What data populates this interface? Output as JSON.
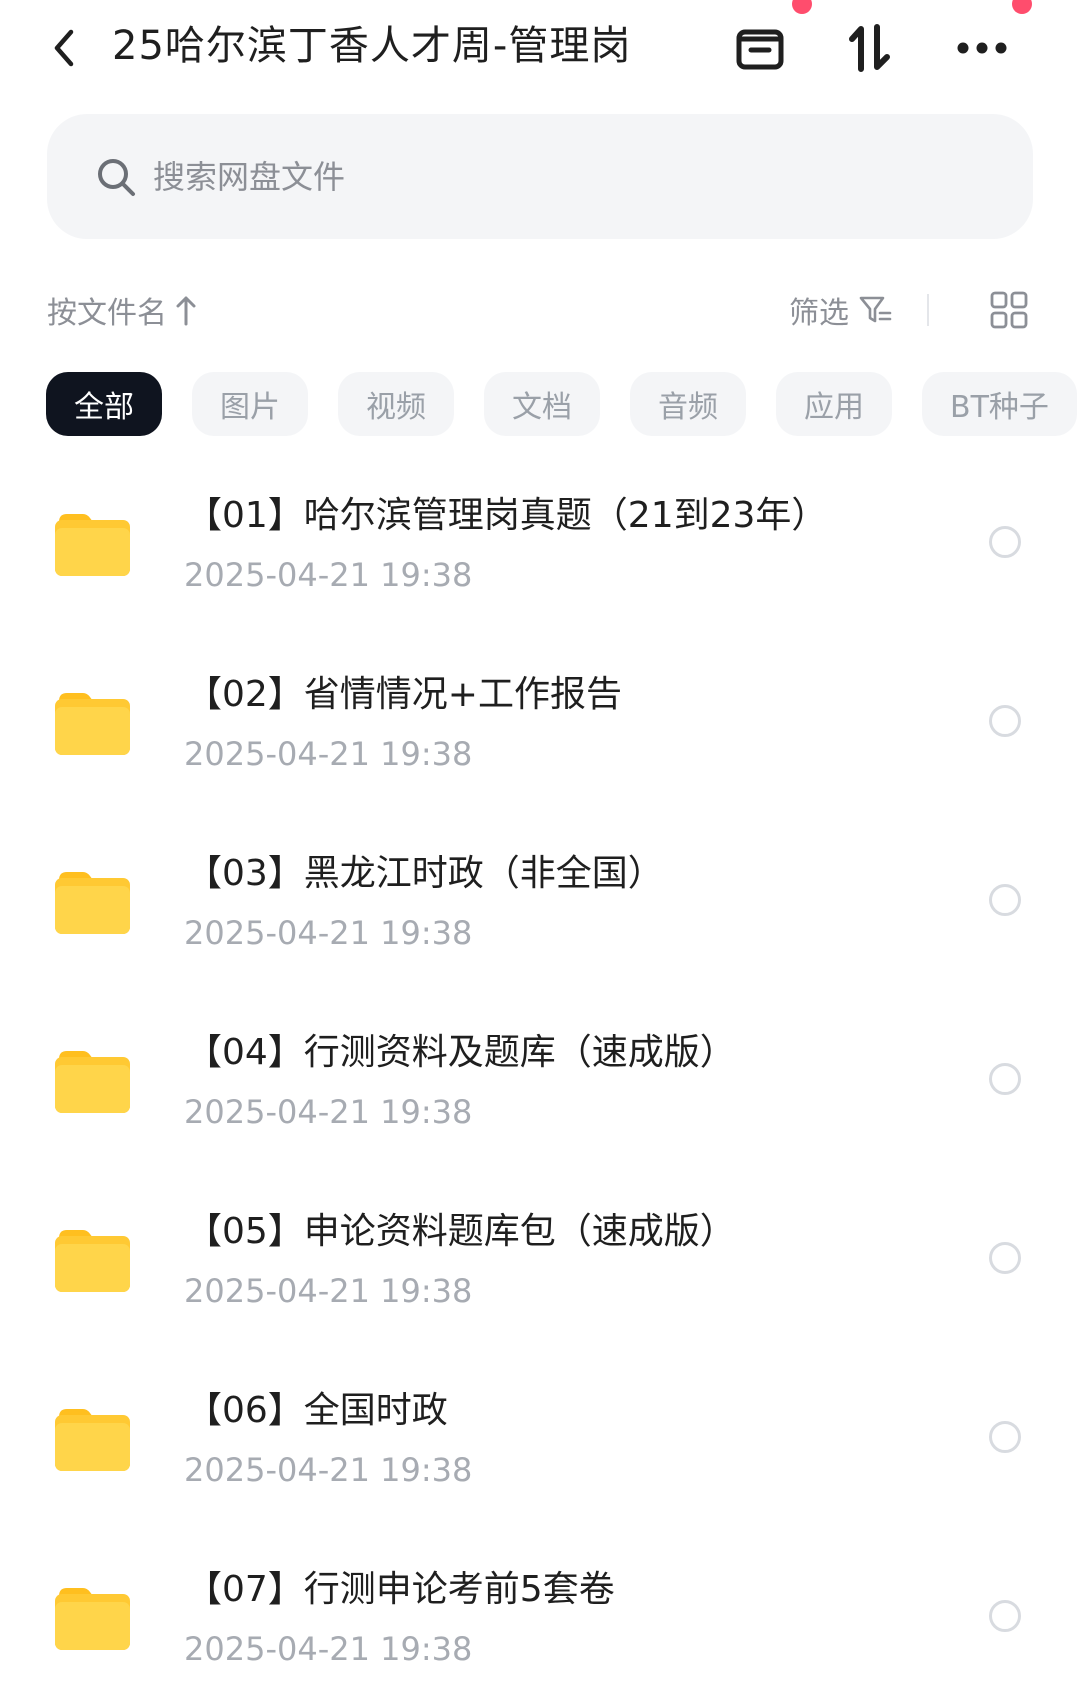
{
  "header": {
    "title": "25哈尔滨丁香人才周-管理岗",
    "icons": {
      "back": "back-arrow-icon",
      "calendar": "calendar-icon",
      "sort": "sort-arrows-icon",
      "more": "more-horizontal-icon"
    },
    "badge_color": "#ff4d6d"
  },
  "search": {
    "placeholder": "搜索网盘文件",
    "value": ""
  },
  "sortbar": {
    "sort_label": "按文件名",
    "filter_label": "筛选",
    "icons": {
      "sort_direction": "arrow-up-icon",
      "filter": "filter-icon",
      "view": "grid-view-icon"
    }
  },
  "categories": [
    {
      "label": "全部",
      "active": true
    },
    {
      "label": "图片",
      "active": false
    },
    {
      "label": "视频",
      "active": false
    },
    {
      "label": "文档",
      "active": false
    },
    {
      "label": "音频",
      "active": false
    },
    {
      "label": "应用",
      "active": false
    },
    {
      "label": "BT种子",
      "active": false
    }
  ],
  "files": [
    {
      "name": "【01】哈尔滨管理岗真题（21到23年）",
      "date": "2025-04-21  19:38",
      "icon": "folder-icon"
    },
    {
      "name": "【02】省情情况+工作报告",
      "date": "2025-04-21  19:38",
      "icon": "folder-icon"
    },
    {
      "name": "【03】黑龙江时政（非全国）",
      "date": "2025-04-21  19:38",
      "icon": "folder-icon"
    },
    {
      "name": "【04】行测资料及题库（速成版）",
      "date": "2025-04-21  19:38",
      "icon": "folder-icon"
    },
    {
      "name": "【05】申论资料题库包（速成版）",
      "date": "2025-04-21  19:38",
      "icon": "folder-icon"
    },
    {
      "name": "【06】全国时政",
      "date": "2025-04-21  19:38",
      "icon": "folder-icon"
    },
    {
      "name": "【07】行测申论考前5套卷",
      "date": "2025-04-21  19:38",
      "icon": "folder-icon"
    }
  ],
  "colors": {
    "folder": "#ffc933",
    "chip_active_bg": "#0f141f",
    "chip_bg": "#f4f5f7",
    "muted_text": "#a7abb2"
  }
}
